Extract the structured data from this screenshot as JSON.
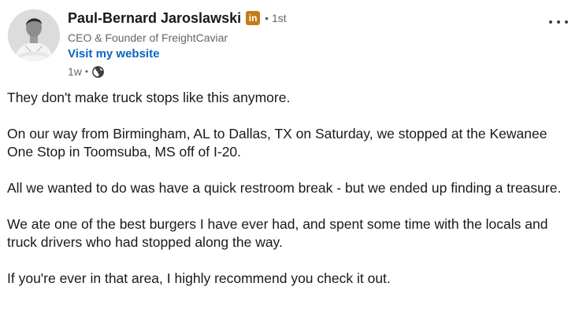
{
  "post": {
    "author": {
      "name": "Paul-Bernard Jaroslawski",
      "badge": "in",
      "separator": "•",
      "degree": "1st",
      "headline": "CEO & Founder of FreightCaviar",
      "website_link": "Visit my website",
      "time": "1w",
      "time_separator": "•",
      "visibility_icon": "globe-icon"
    },
    "menu_icon": "more-horizontal-icon",
    "paragraphs": [
      "They don't make truck stops like this anymore.",
      "On our way from Birmingham, AL to Dallas, TX on Saturday, we stopped at the Kewanee One Stop in Toomsuba, MS off of I-20.",
      "All we wanted to do was have a quick restroom break - but we ended up finding a treasure.",
      "We ate one of the best burgers I have ever had, and spent some time with the locals and truck drivers who had stopped along the way.",
      "If you're ever in that area, I highly recommend you check it out."
    ]
  },
  "colors": {
    "link": "#0a66c2",
    "badge": "#c37d16",
    "text": "#191919",
    "secondary": "#666666"
  }
}
